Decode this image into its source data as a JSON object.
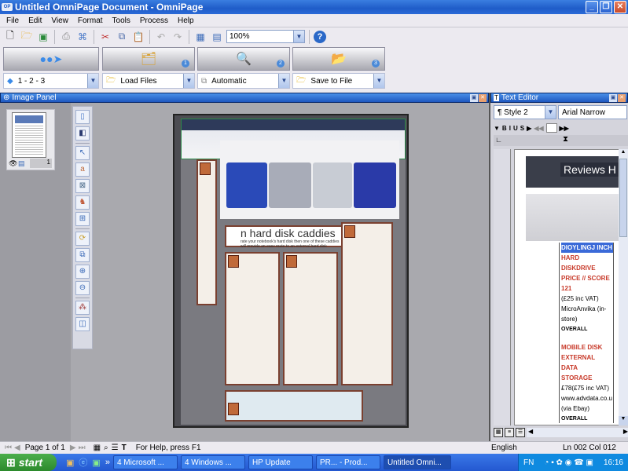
{
  "window": {
    "title": "Untitled OmniPage Document - OmniPage",
    "controls": [
      "minimize",
      "restore",
      "close"
    ]
  },
  "menu": [
    "File",
    "Edit",
    "View",
    "Format",
    "Tools",
    "Process",
    "Help"
  ],
  "toolbar": {
    "buttons": [
      "new-document",
      "open",
      "save",
      "scan",
      "ocr",
      "cut",
      "copy",
      "paste",
      "undo",
      "redo",
      "view-original",
      "view-text"
    ],
    "zoom_value": "100%",
    "help_label": "?"
  },
  "workflow": {
    "steps": [
      {
        "number": "",
        "select": "1 - 2 - 3"
      },
      {
        "number": "1",
        "select": "Load Files"
      },
      {
        "number": "2",
        "select": "Automatic"
      },
      {
        "number": "3",
        "select": "Save to File"
      }
    ]
  },
  "image_panel": {
    "title": "Image Panel",
    "thumbnail_page": "1",
    "document": {
      "headline": "n hard disk caddies",
      "subhead": "rate your notebook's hard disk then one of these caddies will provide an easy route to an external hard disk"
    }
  },
  "text_editor": {
    "title": "Text Editor",
    "style": "Style 2",
    "font": "Arial Narrow",
    "heading": "Reviews H",
    "lines": [
      {
        "text": "DIOYLINGJ INCH",
        "color": "red",
        "highlight": true
      },
      {
        "text": "HARD DISKDRIVE",
        "color": "red"
      },
      {
        "text": "PRICE // SCORE 121",
        "color": "red"
      },
      {
        "text": "(£25 inc VAT)",
        "color": "black"
      },
      {
        "text": "MicroAnvika (in-",
        "color": "black"
      },
      {
        "text": "store)",
        "color": "black"
      },
      {
        "text": "OVERALL",
        "color": "black"
      },
      {
        "text": "MOBILE DISK",
        "color": "red"
      },
      {
        "text": "EXTERNAL DATA",
        "color": "red"
      },
      {
        "text": "STORAGE",
        "color": "red"
      },
      {
        "text": "£78(£75 inc VAT)",
        "color": "black"
      },
      {
        "text": "www.advdata.co.u",
        "color": "black"
      },
      {
        "text": "(via Ebay)",
        "color": "black"
      },
      {
        "text": "OVERALL",
        "color": "black"
      }
    ]
  },
  "status": {
    "page": "Page 1 of 1",
    "help": "For Help, press F1",
    "language": "English",
    "position": "Ln 002  Col 012"
  },
  "taskbar": {
    "start": "start",
    "items": [
      "4 Microsoft ...",
      "4 Windows ...",
      "HP Update",
      "PR... - Prod...",
      "Untitled Omni..."
    ],
    "lang": "FN",
    "clock": "16:16"
  }
}
